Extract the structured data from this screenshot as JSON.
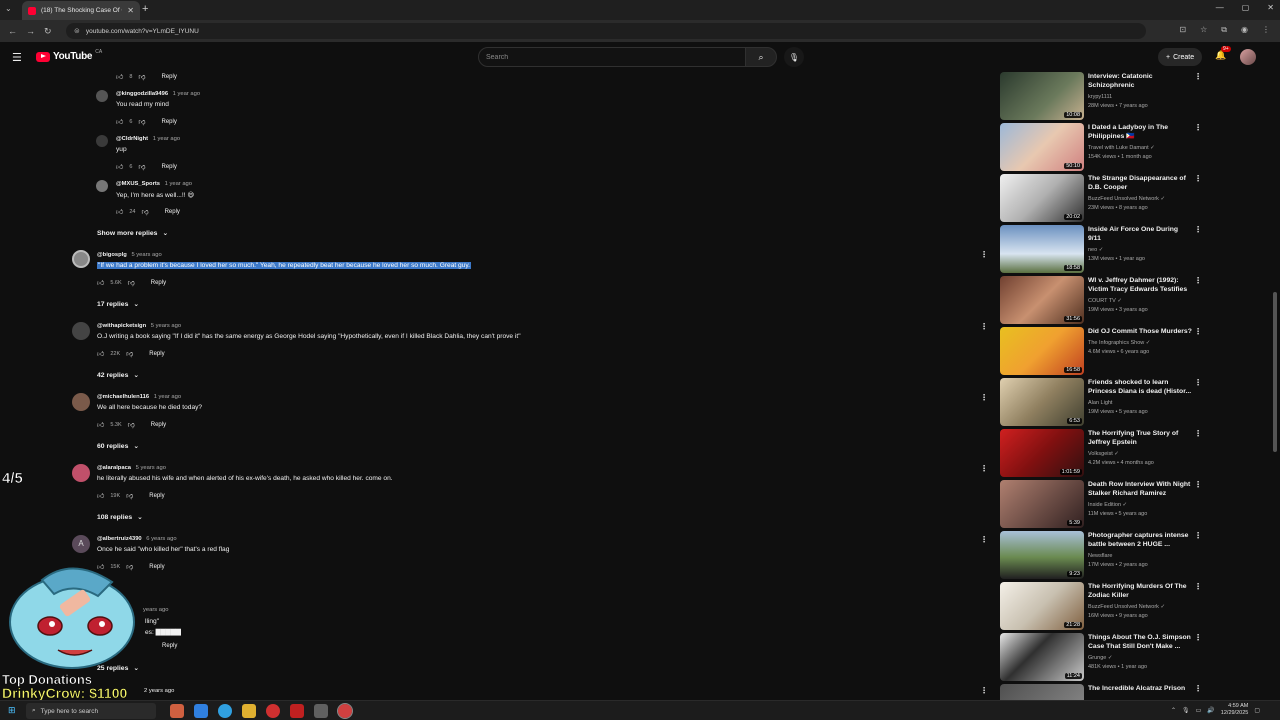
{
  "browser": {
    "tab_title": "(18) The Shocking Case Of O.J.",
    "url": "youtube.com/watch?v=YLmDE_IYUNU"
  },
  "header": {
    "logo_text": "YouTube",
    "country": "CA",
    "search_placeholder": "Search",
    "create_label": "Create",
    "notification_count": "9+"
  },
  "comments": {
    "reply_label": "Reply",
    "show_more_label": "Show more replies",
    "top_like_count": "8",
    "nested_replies": [
      {
        "author": "@kinggodzilla9496",
        "time": "1 year ago",
        "text": "You read my mind",
        "likes": "6"
      },
      {
        "author": "@CldrNight",
        "time": "1 year ago",
        "text": "yup",
        "likes": "6"
      },
      {
        "author": "@MXUS_Sports",
        "time": "1 year ago",
        "text": "Yep, I'm here as well...!! 😄",
        "likes": "24"
      }
    ],
    "threads": [
      {
        "author": "@bigosplg",
        "time": "5 years ago",
        "text": "\"If we had a problem it's because I loved her so much.\" Yeah, he repeatedly beat her because he loved her so much. Great guy.",
        "likes": "5.6K",
        "replies": "17 replies",
        "selected": true
      },
      {
        "author": "@withapicketsign",
        "time": "5 years ago",
        "text": "O.J writing a book saying \"If I did it\" has the same energy as George Hodel saying \"Hypothetically, even if I killed Black Dahlia, they can't prove it\"",
        "likes": "22K",
        "replies": "42 replies"
      },
      {
        "author": "@michaelhulen116",
        "time": "1 year ago",
        "text": "We all here because he died today?",
        "likes": "5.3K",
        "replies": "60 replies"
      },
      {
        "author": "@alaralpaca",
        "time": "5 years ago",
        "text": "he literally abused his wife and when alerted of his ex-wife's death, he asked who killed her. come on.",
        "likes": "19K",
        "replies": "108 replies"
      },
      {
        "author": "@albertruiz4390",
        "time": "6 years ago",
        "text": "Once he said \"who killed her\" that's a red flag",
        "likes": "15K",
        "replies": ""
      }
    ],
    "partial": {
      "time": "years ago",
      "line1": "lling\"",
      "line2": "es: ▇▇▇▇▇",
      "replies": "25 replies",
      "last_time": "2 years ago"
    }
  },
  "sidebar": {
    "videos": [
      {
        "title": "Interview: Catatonic Schizophrenic",
        "channel": "krypy1111",
        "meta": "28M views • 7 years ago",
        "duration": "10:08"
      },
      {
        "title": "I Dated a Ladyboy in The Philippines 🇵🇭",
        "channel": "Travel with Luke Damant ✓",
        "meta": "154K views • 1 month ago",
        "duration": "50:10"
      },
      {
        "title": "The Strange Disappearance of D.B. Cooper",
        "channel": "BuzzFeed Unsolved Network ✓",
        "meta": "23M views • 8 years ago",
        "duration": "20:02"
      },
      {
        "title": "Inside Air Force One During 9/11",
        "channel": "neo ✓",
        "meta": "13M views • 1 year ago",
        "duration": "18:58"
      },
      {
        "title": "WI v. Jeffrey Dahmer (1992): Victim Tracy Edwards Testifies",
        "channel": "COURT TV ✓",
        "meta": "19M views • 3 years ago",
        "duration": "31:56"
      },
      {
        "title": "Did OJ Commit Those Murders?",
        "channel": "The Infographics Show ✓",
        "meta": "4.6M views • 6 years ago",
        "duration": "16:58"
      },
      {
        "title": "Friends shocked to learn Princess Diana is dead (Histor...",
        "channel": "Alan Light",
        "meta": "19M views • 5 years ago",
        "duration": "6:53"
      },
      {
        "title": "The Horrifying True Story of Jeffrey Epstein",
        "channel": "Volksgeist ✓",
        "meta": "4.2M views • 4 months ago",
        "duration": "1:01:59"
      },
      {
        "title": "Death Row Interview With Night Stalker Richard Ramirez",
        "channel": "Inside Edition ✓",
        "meta": "11M views • 5 years ago",
        "duration": "5:39"
      },
      {
        "title": "Photographer captures intense battle between 2 HUGE ...",
        "channel": "Newsflare",
        "meta": "17M views • 2 years ago",
        "duration": "9:23"
      },
      {
        "title": "The Horrifying Murders Of The Zodiac Killer",
        "channel": "BuzzFeed Unsolved Network ✓",
        "meta": "16M views • 9 years ago",
        "duration": "21:28"
      },
      {
        "title": "Things About The O.J. Simpson Case That Still Don't Make ...",
        "channel": "Grunge ✓",
        "meta": "481K views • 1 year ago",
        "duration": "11:24"
      },
      {
        "title": "The Incredible Alcatraz Prison",
        "channel": "",
        "meta": "",
        "duration": ""
      }
    ]
  },
  "overlay": {
    "counter": "4/5",
    "donations_label": "Top Donations",
    "donations_value": "DrinkyCrow: $1100"
  },
  "taskbar": {
    "search_placeholder": "Type here to search",
    "time": "4:59 AM",
    "date": "12/29/2025"
  }
}
